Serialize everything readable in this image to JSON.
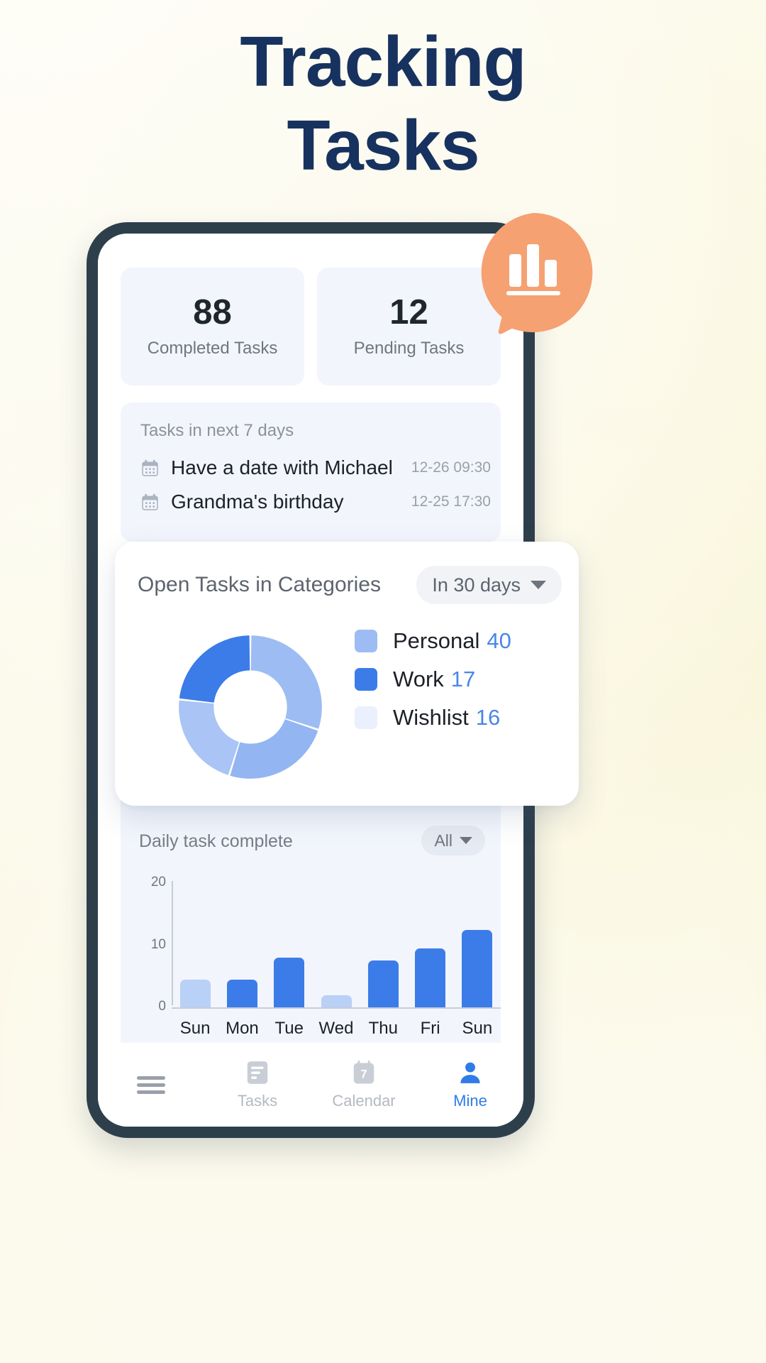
{
  "headline": {
    "line1": "Tracking",
    "line2": "Tasks"
  },
  "colors": {
    "background": "#fbf8e4",
    "headline": "#17325f",
    "phone_frame": "#2e3f4c",
    "card_bg": "#f2f5fc",
    "accent_blue": "#2f7ce8",
    "work_blue": "#3b7ce8",
    "personal_blue": "#9dbcf3",
    "wishlist_blue": "#eaf0fd",
    "badge_orange": "#f5a172"
  },
  "app": {
    "stats": [
      {
        "value": "88",
        "label": "Completed Tasks"
      },
      {
        "value": "12",
        "label": "Pending Tasks"
      }
    ],
    "next_7_days": {
      "title": "Tasks in next 7 days",
      "items": [
        {
          "icon": "calendar-icon",
          "name": "Have a date with Michael",
          "time": "12-26 09:30"
        },
        {
          "icon": "calendar-icon",
          "name": "Grandma's birthday",
          "time": "12-25 17:30"
        }
      ]
    },
    "categories_card": {
      "title": "Open Tasks in Categories",
      "range_label": "In 30 days",
      "range_icon": "chevron-down-icon"
    },
    "daily_card": {
      "title": "Daily task complete",
      "filter_label": "All",
      "filter_icon": "chevron-down-icon"
    },
    "nav": [
      {
        "icon": "menu-icon",
        "label": "",
        "active": false
      },
      {
        "icon": "tasks-icon",
        "label": "Tasks",
        "active": false
      },
      {
        "icon": "calendar-7-icon",
        "label": "Calendar",
        "active": false
      },
      {
        "icon": "person-icon",
        "label": "Mine",
        "active": true
      }
    ],
    "badge": {
      "icon": "bar-chart-icon"
    }
  },
  "chart_data": [
    {
      "type": "pie",
      "title": "Open Tasks in Categories",
      "subtitle": "In 30 days",
      "legend_position": "right",
      "donut": true,
      "categories": [
        "Personal",
        "Work",
        "Wishlist"
      ],
      "values": [
        40,
        17,
        16
      ],
      "slices": [
        {
          "name": "Personal",
          "value": 40,
          "color": "#9dbcf3"
        },
        {
          "name": "Work",
          "value": 17,
          "color": "#3b7ce8"
        },
        {
          "name": "Wishlist",
          "value": 16,
          "color": "#eaf0fd"
        }
      ]
    },
    {
      "type": "bar",
      "title": "Daily task complete",
      "subtitle": "All",
      "categories": [
        "Sun",
        "Mon",
        "Tue",
        "Wed",
        "Thu",
        "Fri",
        "Sun"
      ],
      "values": [
        4.5,
        4.5,
        8,
        2,
        7.5,
        9.5,
        12.5
      ],
      "bar_colors": [
        "#b9d0f7",
        "#3b7ce8",
        "#3b7ce8",
        "#b9d0f7",
        "#3b7ce8",
        "#3b7ce8",
        "#3b7ce8"
      ],
      "xlabel": "",
      "ylabel": "",
      "ylim": [
        0,
        20
      ],
      "yticks": [
        "0",
        "10",
        "20"
      ],
      "grid": false
    }
  ]
}
